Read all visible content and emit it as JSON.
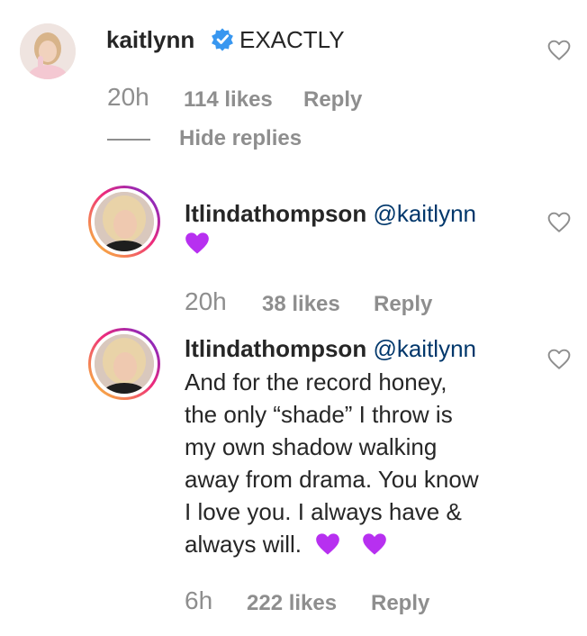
{
  "comments": [
    {
      "username": "kaitlynn",
      "text": "EXACTLY",
      "time": "20h",
      "likes": "114 likes",
      "reply": "Reply"
    },
    {
      "username": "ltlindathompson",
      "mention": "@kaitlynn",
      "time": "20h",
      "likes": "38 likes",
      "reply": "Reply"
    },
    {
      "username": "ltlindathompson",
      "mention": "@kaitlynn",
      "lines": [
        "And for the record honey,",
        "the only “shade” I throw is",
        "my own shadow walking",
        "away from drama. You know",
        "I love you. I always have &",
        "always will."
      ],
      "time": "6h",
      "likes": "222 likes",
      "reply": "Reply"
    }
  ],
  "hide_replies": "Hide replies",
  "icons": {
    "verified": "verified-badge-icon",
    "like": "heart-outline-icon",
    "emoji": "purple-heart-emoji"
  },
  "colors": {
    "verified": "#3897f0",
    "mention": "#00376b",
    "meta": "#8e8e8e",
    "purple_heart": "#b730f0"
  }
}
